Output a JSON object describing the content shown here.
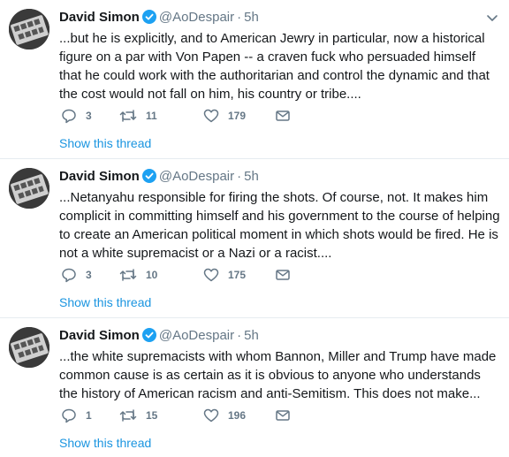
{
  "tweets": [
    {
      "name": "David Simon",
      "handle": "@AoDespair",
      "separator": "·",
      "time": "5h",
      "text": "...but he is explicitly, and to American Jewry in particular, now a historical figure on a par with Von Papen -- a craven fuck who persuaded himself that he could work with the authoritarian and control the dynamic and that the cost would not fall on him, his country or tribe....",
      "replies": "3",
      "retweets": "11",
      "likes": "179",
      "show_thread": "Show this thread"
    },
    {
      "name": "David Simon",
      "handle": "@AoDespair",
      "separator": "·",
      "time": "5h",
      "text": "...Netanyahu responsible for firing the shots. Of course, not. It makes him complicit in committing himself and his government to the course of helping to create an American political moment in which shots would be fired. He is not a white supremacist or a Nazi or a racist....",
      "replies": "3",
      "retweets": "10",
      "likes": "175",
      "show_thread": "Show this thread"
    },
    {
      "name": "David Simon",
      "handle": "@AoDespair",
      "separator": "·",
      "time": "5h",
      "text": "...the white supremacists with whom Bannon, Miller and Trump have made common cause is as certain as it is obvious to anyone who understands the history of American racism and anti-Semitism. This does not make...",
      "replies": "1",
      "retweets": "15",
      "likes": "196",
      "show_thread": "Show this thread"
    }
  ],
  "icons": {
    "verified": "verified-badge-icon",
    "caret": "chevron-down-icon",
    "reply": "reply-icon",
    "retweet": "retweet-icon",
    "like": "heart-icon",
    "dm": "envelope-icon"
  },
  "colors": {
    "link": "#1b95e0",
    "muted": "#657786",
    "verified": "#1da1f2",
    "text": "#14171a"
  }
}
